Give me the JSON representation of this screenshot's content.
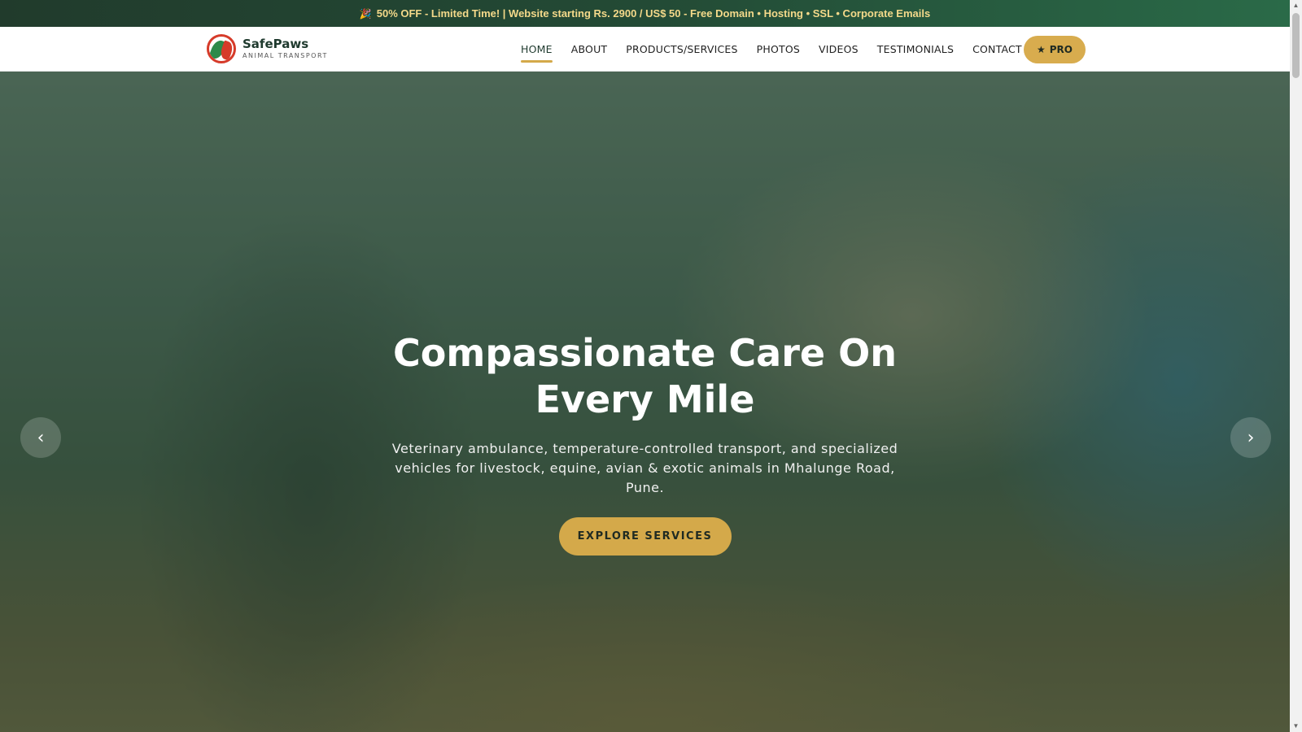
{
  "promo": {
    "icon": "party-popper-icon",
    "text": "50% OFF - Limited Time! | Website starting Rs. 2900 / US$ 50 - Free Domain • Hosting • SSL • Corporate Emails"
  },
  "brand": {
    "name": "SafePaws",
    "tagline": "ANIMAL TRANSPORT"
  },
  "nav": {
    "items": [
      {
        "label": "HOME",
        "active": true
      },
      {
        "label": "ABOUT"
      },
      {
        "label": "PRODUCTS/SERVICES"
      },
      {
        "label": "PHOTOS"
      },
      {
        "label": "VIDEOS"
      },
      {
        "label": "TESTIMONIALS"
      },
      {
        "label": "CONTACT"
      }
    ],
    "pro_label": "PRO"
  },
  "hero": {
    "title": "Compassionate Care On Every Mile",
    "subtitle": "Veterinary ambulance, temperature-controlled transport, and specialized vehicles for livestock, equine, avian & exotic animals in Mhalunge Road, Pune.",
    "cta_label": "EXPLORE SERVICES",
    "prev_icon": "chevron-left-icon",
    "next_icon": "chevron-right-icon"
  },
  "colors": {
    "accent": "#d4a94a",
    "brand_dark": "#1f3a2e",
    "promo_text": "#f4d98a"
  }
}
